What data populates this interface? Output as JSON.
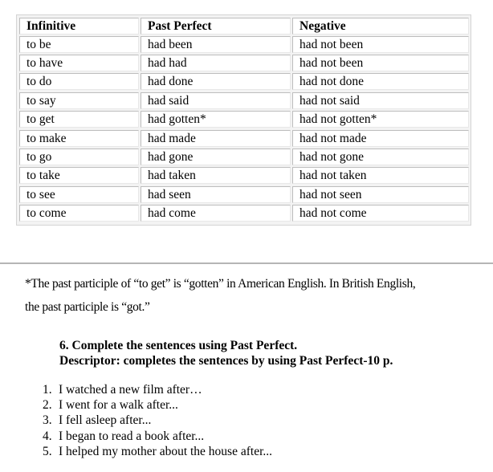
{
  "table": {
    "headers": [
      "Infinitive",
      "Past Perfect",
      "Negative"
    ],
    "rows": [
      [
        "to be",
        "had been",
        "had not been"
      ],
      [
        "to have",
        "had had",
        "had not been"
      ],
      [
        "to do",
        "had done",
        "had not done"
      ],
      [
        "to say",
        "had said",
        "had not said"
      ],
      [
        "to get",
        "had gotten*",
        "had not gotten*"
      ],
      [
        "to make",
        "had made",
        "had not made"
      ],
      [
        "to go",
        "had gone",
        "had not gone"
      ],
      [
        "to take",
        "had taken",
        "had not taken"
      ],
      [
        "to see",
        "had seen",
        "had not seen"
      ],
      [
        "to come",
        "had come",
        "had not come"
      ]
    ]
  },
  "footnote": {
    "line1": "*The past participle of “to get” is “gotten” in American English. In British English,",
    "line2": "the past participle is “got.”"
  },
  "task": {
    "title": "6. Complete the sentences using Past Perfect.",
    "descriptor": "Descriptor: completes the sentences by using Past Perfect-10 p."
  },
  "exercises": [
    {
      "num": "1.",
      "text": "I watched a new film after…"
    },
    {
      "num": "2.",
      "text": "I went for a walk after..."
    },
    {
      "num": "3.",
      "text": "I fell asleep after..."
    },
    {
      "num": "4.",
      "text": "I began to read a book after..."
    },
    {
      "num": "5.",
      "text": "I helped my mother about the house after..."
    }
  ]
}
